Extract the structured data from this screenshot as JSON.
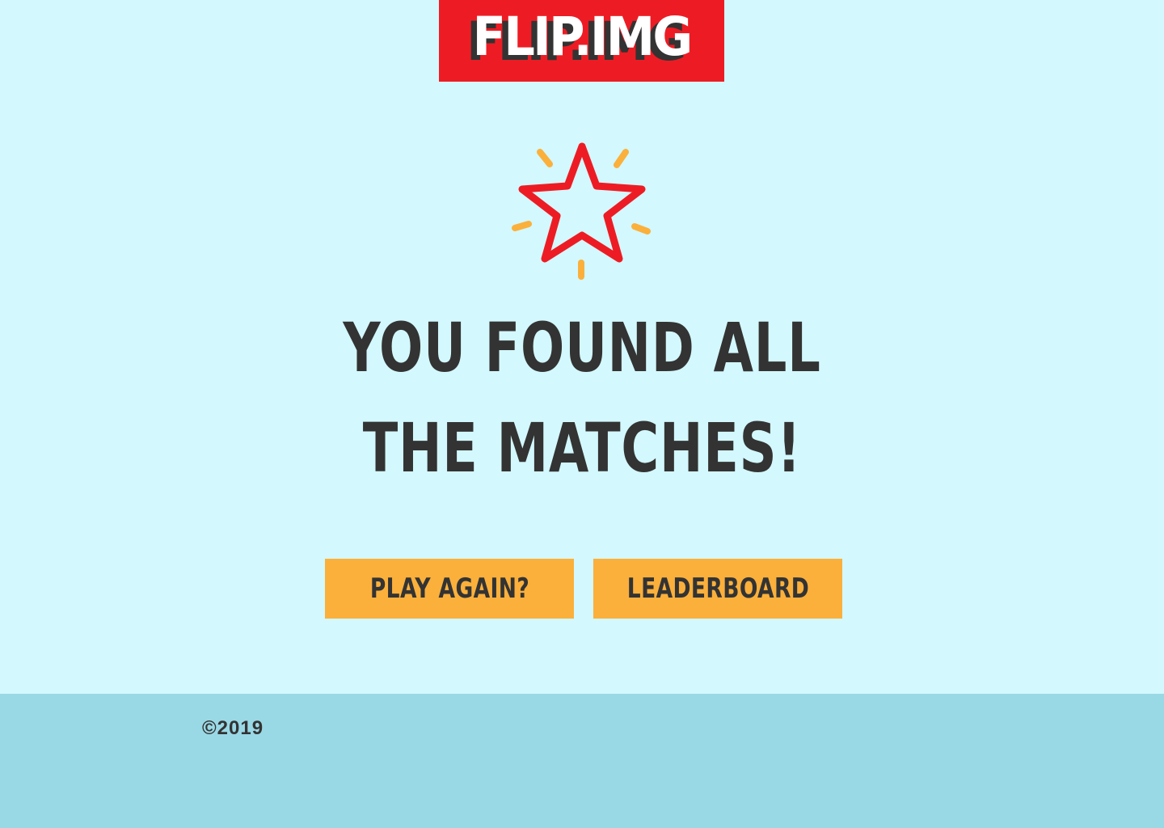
{
  "header": {
    "logo_text": "FLIP.IMG"
  },
  "main": {
    "icon": "star-burst-icon",
    "headline_line1": "YOU FOUND ALL",
    "headline_line2": "THE MATCHES!",
    "buttons": {
      "play_again_label": "PLAY AGAIN?",
      "leaderboard_label": "LEADERBOARD"
    }
  },
  "footer": {
    "copyright": "©2019"
  },
  "colors": {
    "background": "#d3f8fd",
    "footer_background": "#99d9e5",
    "logo_background": "#ed1c24",
    "star_stroke": "#ed1c24",
    "sparkle": "#fbb03b",
    "button_background": "#fbb03b",
    "text": "#333333"
  }
}
